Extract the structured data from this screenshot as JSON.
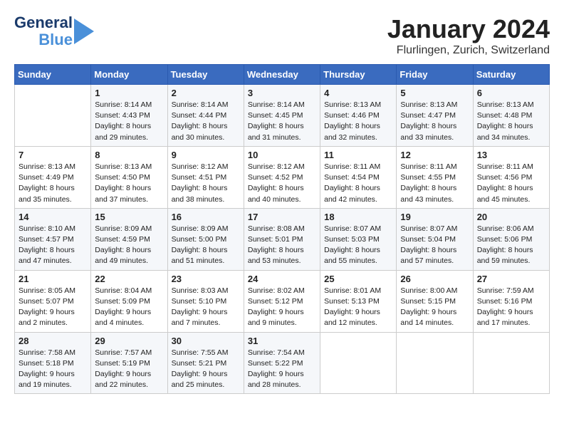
{
  "logo": {
    "line1": "General",
    "line2": "Blue"
  },
  "title": "January 2024",
  "location": "Flurlingen, Zurich, Switzerland",
  "weekdays": [
    "Sunday",
    "Monday",
    "Tuesday",
    "Wednesday",
    "Thursday",
    "Friday",
    "Saturday"
  ],
  "weeks": [
    [
      {
        "day": "",
        "sunrise": "",
        "sunset": "",
        "daylight": ""
      },
      {
        "day": "1",
        "sunrise": "Sunrise: 8:14 AM",
        "sunset": "Sunset: 4:43 PM",
        "daylight": "Daylight: 8 hours and 29 minutes."
      },
      {
        "day": "2",
        "sunrise": "Sunrise: 8:14 AM",
        "sunset": "Sunset: 4:44 PM",
        "daylight": "Daylight: 8 hours and 30 minutes."
      },
      {
        "day": "3",
        "sunrise": "Sunrise: 8:14 AM",
        "sunset": "Sunset: 4:45 PM",
        "daylight": "Daylight: 8 hours and 31 minutes."
      },
      {
        "day": "4",
        "sunrise": "Sunrise: 8:13 AM",
        "sunset": "Sunset: 4:46 PM",
        "daylight": "Daylight: 8 hours and 32 minutes."
      },
      {
        "day": "5",
        "sunrise": "Sunrise: 8:13 AM",
        "sunset": "Sunset: 4:47 PM",
        "daylight": "Daylight: 8 hours and 33 minutes."
      },
      {
        "day": "6",
        "sunrise": "Sunrise: 8:13 AM",
        "sunset": "Sunset: 4:48 PM",
        "daylight": "Daylight: 8 hours and 34 minutes."
      }
    ],
    [
      {
        "day": "7",
        "sunrise": "Sunrise: 8:13 AM",
        "sunset": "Sunset: 4:49 PM",
        "daylight": "Daylight: 8 hours and 35 minutes."
      },
      {
        "day": "8",
        "sunrise": "Sunrise: 8:13 AM",
        "sunset": "Sunset: 4:50 PM",
        "daylight": "Daylight: 8 hours and 37 minutes."
      },
      {
        "day": "9",
        "sunrise": "Sunrise: 8:12 AM",
        "sunset": "Sunset: 4:51 PM",
        "daylight": "Daylight: 8 hours and 38 minutes."
      },
      {
        "day": "10",
        "sunrise": "Sunrise: 8:12 AM",
        "sunset": "Sunset: 4:52 PM",
        "daylight": "Daylight: 8 hours and 40 minutes."
      },
      {
        "day": "11",
        "sunrise": "Sunrise: 8:11 AM",
        "sunset": "Sunset: 4:54 PM",
        "daylight": "Daylight: 8 hours and 42 minutes."
      },
      {
        "day": "12",
        "sunrise": "Sunrise: 8:11 AM",
        "sunset": "Sunset: 4:55 PM",
        "daylight": "Daylight: 8 hours and 43 minutes."
      },
      {
        "day": "13",
        "sunrise": "Sunrise: 8:11 AM",
        "sunset": "Sunset: 4:56 PM",
        "daylight": "Daylight: 8 hours and 45 minutes."
      }
    ],
    [
      {
        "day": "14",
        "sunrise": "Sunrise: 8:10 AM",
        "sunset": "Sunset: 4:57 PM",
        "daylight": "Daylight: 8 hours and 47 minutes."
      },
      {
        "day": "15",
        "sunrise": "Sunrise: 8:09 AM",
        "sunset": "Sunset: 4:59 PM",
        "daylight": "Daylight: 8 hours and 49 minutes."
      },
      {
        "day": "16",
        "sunrise": "Sunrise: 8:09 AM",
        "sunset": "Sunset: 5:00 PM",
        "daylight": "Daylight: 8 hours and 51 minutes."
      },
      {
        "day": "17",
        "sunrise": "Sunrise: 8:08 AM",
        "sunset": "Sunset: 5:01 PM",
        "daylight": "Daylight: 8 hours and 53 minutes."
      },
      {
        "day": "18",
        "sunrise": "Sunrise: 8:07 AM",
        "sunset": "Sunset: 5:03 PM",
        "daylight": "Daylight: 8 hours and 55 minutes."
      },
      {
        "day": "19",
        "sunrise": "Sunrise: 8:07 AM",
        "sunset": "Sunset: 5:04 PM",
        "daylight": "Daylight: 8 hours and 57 minutes."
      },
      {
        "day": "20",
        "sunrise": "Sunrise: 8:06 AM",
        "sunset": "Sunset: 5:06 PM",
        "daylight": "Daylight: 8 hours and 59 minutes."
      }
    ],
    [
      {
        "day": "21",
        "sunrise": "Sunrise: 8:05 AM",
        "sunset": "Sunset: 5:07 PM",
        "daylight": "Daylight: 9 hours and 2 minutes."
      },
      {
        "day": "22",
        "sunrise": "Sunrise: 8:04 AM",
        "sunset": "Sunset: 5:09 PM",
        "daylight": "Daylight: 9 hours and 4 minutes."
      },
      {
        "day": "23",
        "sunrise": "Sunrise: 8:03 AM",
        "sunset": "Sunset: 5:10 PM",
        "daylight": "Daylight: 9 hours and 7 minutes."
      },
      {
        "day": "24",
        "sunrise": "Sunrise: 8:02 AM",
        "sunset": "Sunset: 5:12 PM",
        "daylight": "Daylight: 9 hours and 9 minutes."
      },
      {
        "day": "25",
        "sunrise": "Sunrise: 8:01 AM",
        "sunset": "Sunset: 5:13 PM",
        "daylight": "Daylight: 9 hours and 12 minutes."
      },
      {
        "day": "26",
        "sunrise": "Sunrise: 8:00 AM",
        "sunset": "Sunset: 5:15 PM",
        "daylight": "Daylight: 9 hours and 14 minutes."
      },
      {
        "day": "27",
        "sunrise": "Sunrise: 7:59 AM",
        "sunset": "Sunset: 5:16 PM",
        "daylight": "Daylight: 9 hours and 17 minutes."
      }
    ],
    [
      {
        "day": "28",
        "sunrise": "Sunrise: 7:58 AM",
        "sunset": "Sunset: 5:18 PM",
        "daylight": "Daylight: 9 hours and 19 minutes."
      },
      {
        "day": "29",
        "sunrise": "Sunrise: 7:57 AM",
        "sunset": "Sunset: 5:19 PM",
        "daylight": "Daylight: 9 hours and 22 minutes."
      },
      {
        "day": "30",
        "sunrise": "Sunrise: 7:55 AM",
        "sunset": "Sunset: 5:21 PM",
        "daylight": "Daylight: 9 hours and 25 minutes."
      },
      {
        "day": "31",
        "sunrise": "Sunrise: 7:54 AM",
        "sunset": "Sunset: 5:22 PM",
        "daylight": "Daylight: 9 hours and 28 minutes."
      },
      {
        "day": "",
        "sunrise": "",
        "sunset": "",
        "daylight": ""
      },
      {
        "day": "",
        "sunrise": "",
        "sunset": "",
        "daylight": ""
      },
      {
        "day": "",
        "sunrise": "",
        "sunset": "",
        "daylight": ""
      }
    ]
  ]
}
